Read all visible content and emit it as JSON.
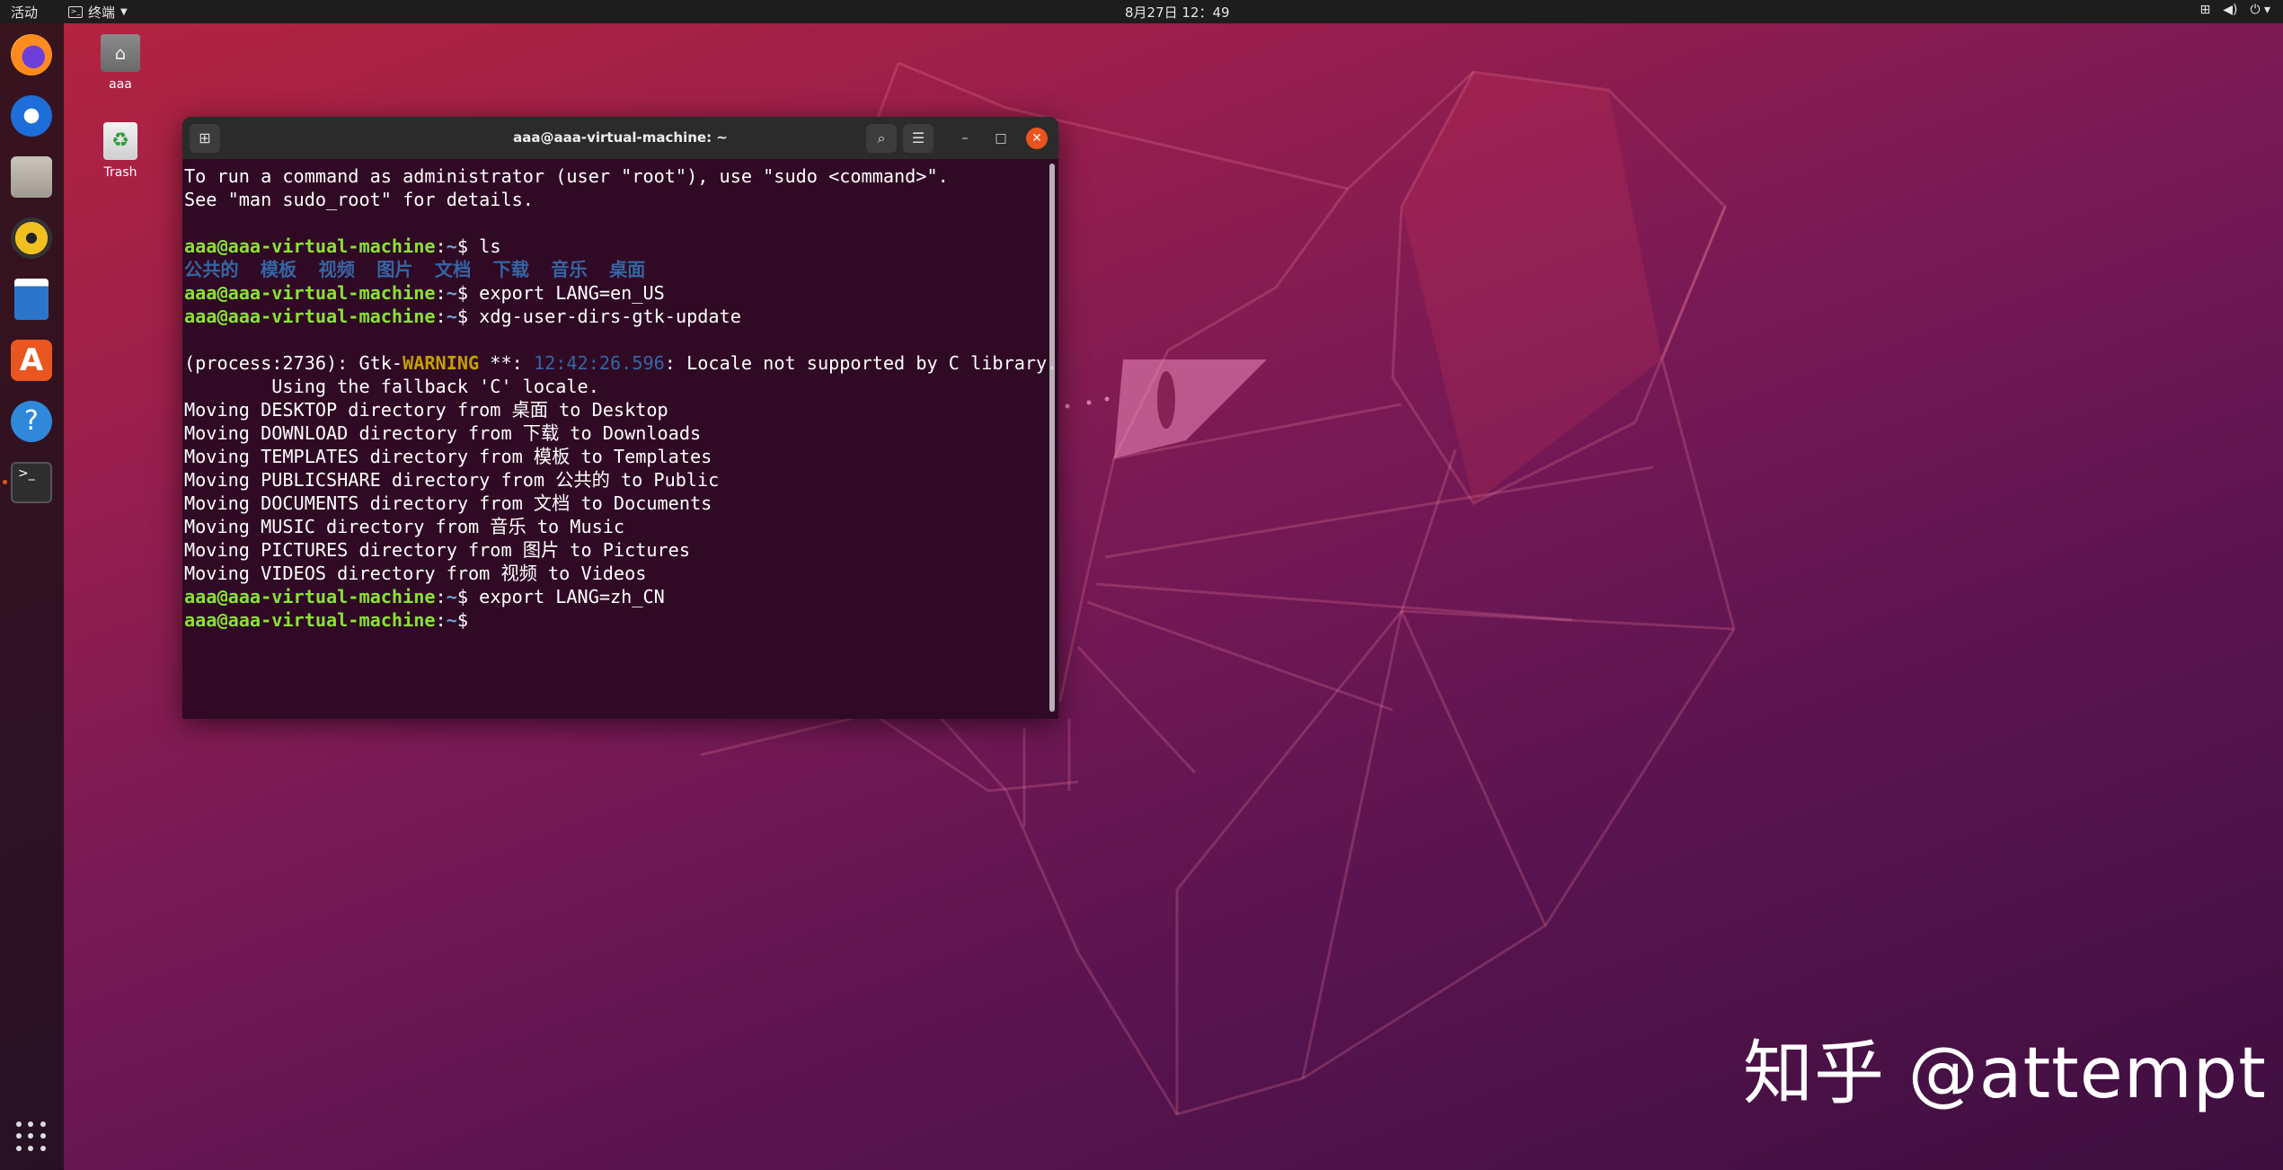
{
  "topbar": {
    "activities": "活动",
    "app_menu": "终端",
    "clock": "8月27日 12：49",
    "tray": {
      "network_icon": "network-icon",
      "volume_icon": "volume-icon",
      "power_icon": "power-icon"
    }
  },
  "dock": {
    "items": [
      "firefox-icon",
      "thunderbird-icon",
      "files-icon",
      "rhythmbox-icon",
      "writer-icon",
      "software-icon",
      "help-icon",
      "terminal-icon"
    ],
    "apps_grid_icon": "show-apps-icon"
  },
  "desktop": {
    "icons": [
      {
        "label": "aaa",
        "icon": "home-folder-icon"
      },
      {
        "label": "Trash",
        "icon": "trash-icon"
      }
    ]
  },
  "terminal": {
    "title": "aaa@aaa-virtual-machine: ~",
    "lines": {
      "l1": "To run a command as administrator (user \"root\"), use \"sudo <command>\".",
      "l2": "See \"man sudo_root\" for details.",
      "user": "aaa@aaa-virtual-machine",
      "path": "~",
      "cmd1": "ls",
      "ls_output": "公共的  模板  视频  图片  文档  下载  音乐  桌面",
      "cmd2": "export LANG=en_US",
      "cmd3": "xdg-user-dirs-gtk-update",
      "warn_prefix": "(process:2736): Gtk-",
      "warn_word": "WARNING",
      "warn_stars": " **: ",
      "warn_time": "12:42:26.596",
      "warn_msg": ": Locale not supported by C library.",
      "fallback": "        Using the fallback 'C' locale.",
      "m1": "Moving DESKTOP directory from 桌面 to Desktop",
      "m2": "Moving DOWNLOAD directory from 下载 to Downloads",
      "m3": "Moving TEMPLATES directory from 模板 to Templates",
      "m4": "Moving PUBLICSHARE directory from 公共的 to Public",
      "m5": "Moving DOCUMENTS directory from 文档 to Documents",
      "m6": "Moving MUSIC directory from 音乐 to Music",
      "m7": "Moving PICTURES directory from 图片 to Pictures",
      "m8": "Moving VIDEOS directory from 视频 to Videos",
      "cmd4": "export LANG=zh_CN"
    }
  },
  "watermark": "知乎 @attempt",
  "colors": {
    "accent": "#e95420",
    "terminal_bg": "#300a24",
    "user_green": "#8ae234",
    "path_blue": "#729fcf"
  }
}
